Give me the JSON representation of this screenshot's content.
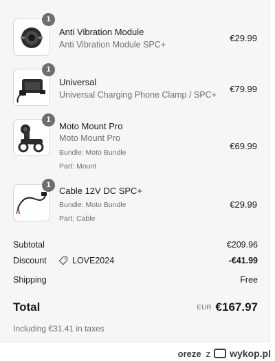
{
  "items": [
    {
      "qty": "1",
      "name": "Anti Vibration Module",
      "subtitle": "Anti Vibration Module SPC+",
      "meta": [],
      "price": "€29.99",
      "icon": "vibration-module-icon"
    },
    {
      "qty": "1",
      "name": "Universal",
      "subtitle": "Universal Charging Phone Clamp / SPC+",
      "meta": [],
      "price": "€79.99",
      "icon": "phone-clamp-icon"
    },
    {
      "qty": "1",
      "name": "Moto Mount Pro",
      "subtitle": "Moto Mount Pro",
      "meta": [
        "Bundle: Moto Bundle",
        "Part: Mount"
      ],
      "price": "€69.99",
      "icon": "moto-mount-icon"
    },
    {
      "qty": "1",
      "name": "Cable 12V DC SPC+",
      "subtitle": "",
      "meta": [
        "Bundle: Moto Bundle",
        "Part: Cable"
      ],
      "price": "€29.99",
      "icon": "cable-icon"
    }
  ],
  "summary": {
    "subtotal_label": "Subtotal",
    "subtotal_value": "€209.96",
    "discount_label": "Discount",
    "discount_code": "LOVE2024",
    "discount_value": "-€41.99",
    "shipping_label": "Shipping",
    "shipping_value": "Free",
    "total_label": "Total",
    "total_currency": "EUR",
    "total_value": "€167.97",
    "taxes_note": "Including €31.41 in taxes"
  },
  "watermark": {
    "user": "oreze",
    "separator": "z",
    "site": "wykop.pl"
  },
  "colors": {
    "panel_bg": "#f6f6f6",
    "badge_bg": "#6e6e6e",
    "muted_text": "#6f6f6f"
  }
}
